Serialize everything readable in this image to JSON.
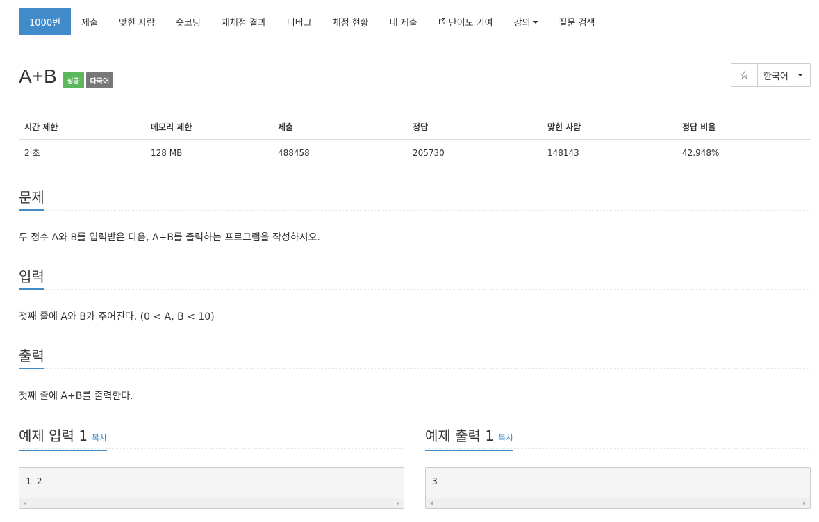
{
  "nav": {
    "items": [
      {
        "label": "1000번",
        "active": true
      },
      {
        "label": "제출"
      },
      {
        "label": "맞힌 사람"
      },
      {
        "label": "숏코딩"
      },
      {
        "label": "재채점 결과"
      },
      {
        "label": "디버그"
      },
      {
        "label": "채점 현황"
      },
      {
        "label": "내 제출"
      },
      {
        "label": "난이도 기여",
        "icon": "external-link-icon"
      },
      {
        "label": "강의",
        "dropdown": true
      },
      {
        "label": "질문 검색"
      }
    ]
  },
  "problem": {
    "title": "A+B",
    "labels": {
      "status": "성공",
      "multilang": "다국어"
    },
    "star_glyph": "☆",
    "language": "한국어"
  },
  "info_table": {
    "headers": [
      "시간 제한",
      "메모리 제한",
      "제출",
      "정답",
      "맞힌 사람",
      "정답 비율"
    ],
    "values": [
      "2 초",
      "128 MB",
      "488458",
      "205730",
      "148143",
      "42.948%"
    ]
  },
  "sections": {
    "problem": {
      "title": "문제",
      "text": "두 정수 A와 B를 입력받은 다음, A+B를 출력하는 프로그램을 작성하시오."
    },
    "input": {
      "title": "입력",
      "text": "첫째 줄에 A와 B가 주어진다. (0 < A, B < 10)"
    },
    "output": {
      "title": "출력",
      "text": "첫째 줄에 A+B를 출력한다."
    }
  },
  "samples": {
    "input": {
      "title": "예제 입력 1",
      "copy_label": "복사",
      "content": "1 2"
    },
    "output": {
      "title": "예제 출력 1",
      "copy_label": "복사",
      "content": "3"
    }
  },
  "colors": {
    "accent": "#428bca",
    "success": "#5cb85c",
    "default_label": "#777777"
  }
}
